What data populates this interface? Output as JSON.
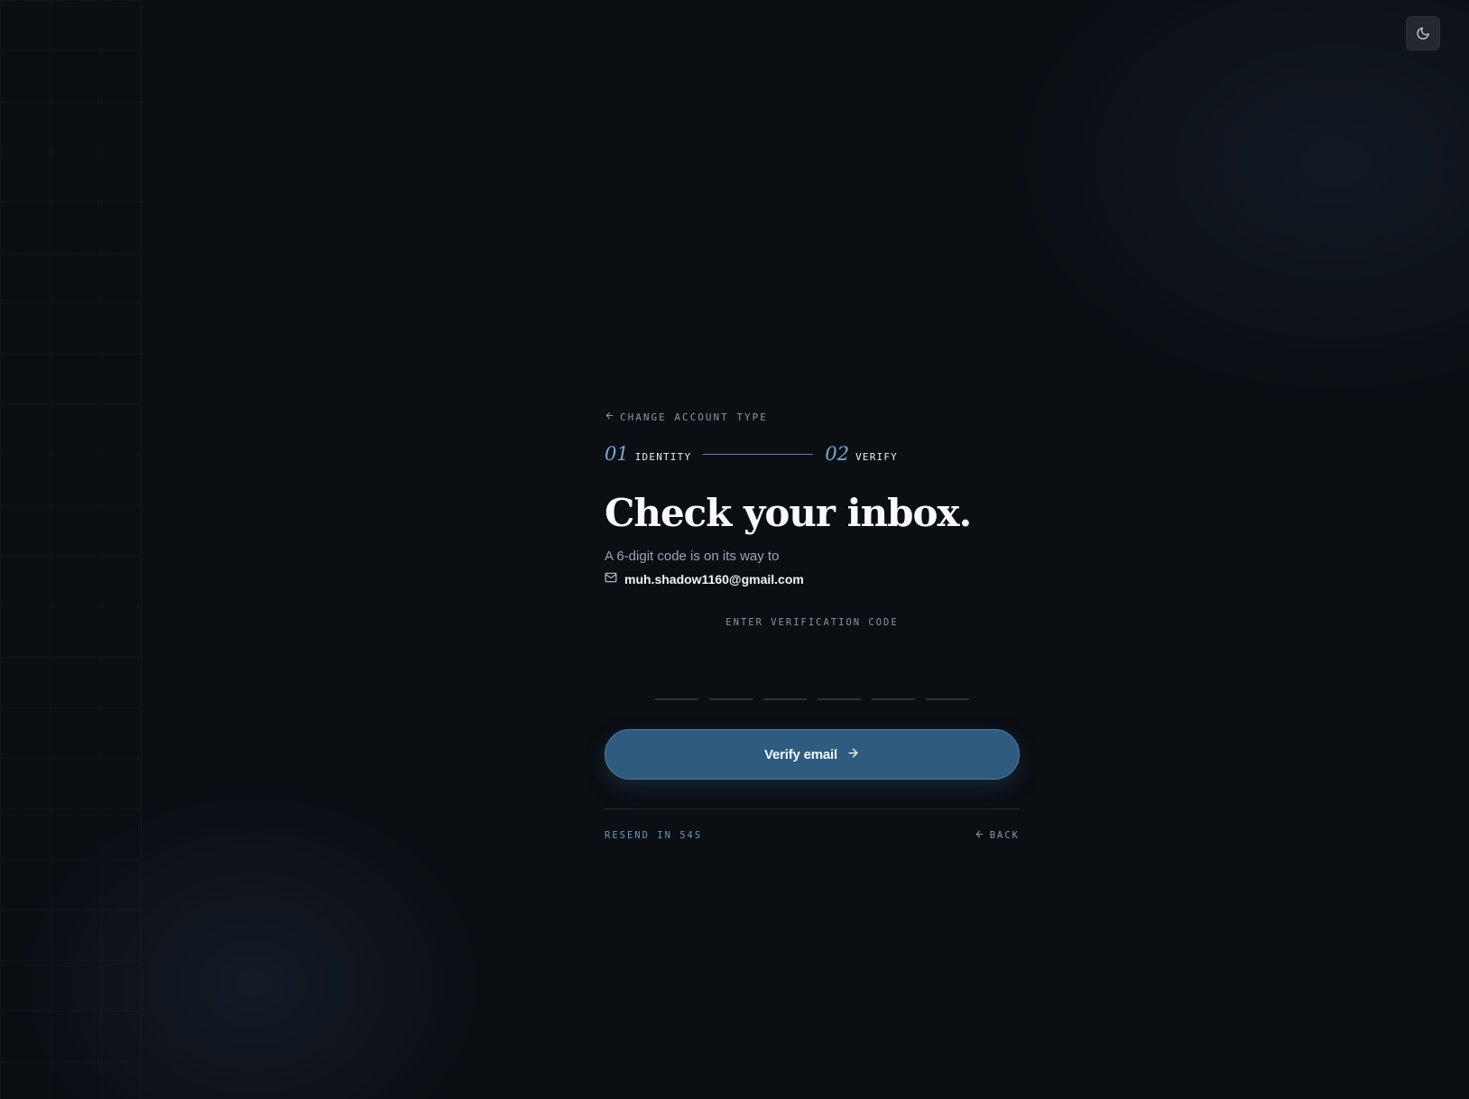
{
  "colors": {
    "background": "#0b0e13",
    "accent": "#7ba6d8",
    "button": "#2f5b7e",
    "muted": "#8a96a6"
  },
  "theme_toggle": {
    "icon": "moon-icon"
  },
  "nav": {
    "change_account_type": "CHANGE ACCOUNT TYPE",
    "icon": "arrow-left-icon"
  },
  "stepper": {
    "steps": [
      {
        "number": "01",
        "label": "IDENTITY"
      },
      {
        "number": "02",
        "label": "VERIFY"
      }
    ]
  },
  "heading": "Check your inbox.",
  "subtext": "A 6-digit code is on its way to",
  "email": {
    "icon": "mail-icon",
    "address": "muh.shadow1160@gmail.com"
  },
  "verification": {
    "label": "ENTER VERIFICATION CODE",
    "digits": [
      "",
      "",
      "",
      "",
      "",
      ""
    ]
  },
  "verify_button": {
    "label": "Verify email",
    "icon": "arrow-right-icon"
  },
  "footer": {
    "resend": "RESEND IN 54S",
    "back": "BACK",
    "back_icon": "arrow-left-icon"
  }
}
